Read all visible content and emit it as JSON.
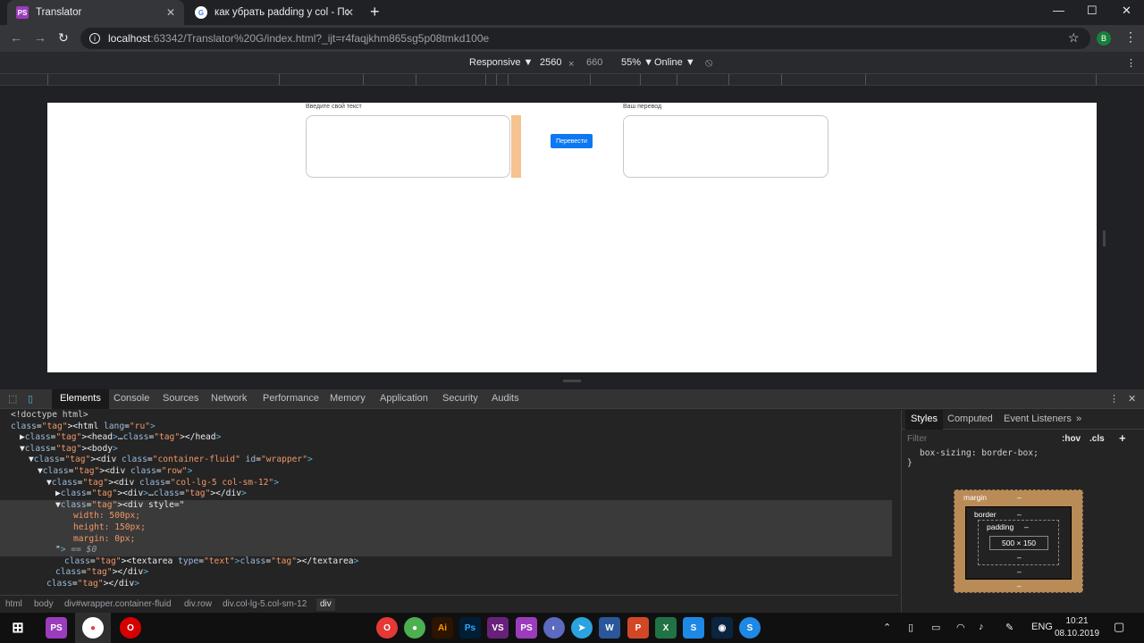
{
  "browser": {
    "tabs": [
      {
        "title": "Translator",
        "icon": "phpstorm-icon",
        "active": true
      },
      {
        "title": "как убрать padding у col - Поис",
        "icon": "google-icon",
        "active": false
      }
    ],
    "close_glyph": "✕",
    "new_tab_glyph": "+",
    "window_controls": {
      "minimize": "—",
      "maximize": "☐",
      "close": "✕"
    },
    "url": {
      "host": "localhost",
      "rest": ":63342/Translator%20G/index.html?_ijt=r4faqjkhm865sg5p08tmkd100e"
    },
    "nav": {
      "back": "←",
      "forward": "→",
      "reload": "↻",
      "info": "i",
      "star": "☆",
      "profile": "B",
      "menu": "⋮"
    }
  },
  "device_toolbar": {
    "mode": "Responsive ▼",
    "width": "2560",
    "times": "×",
    "height": "660",
    "zoom": "55% ▼",
    "network": "Online ▼",
    "rotate": "⦸",
    "menu": "⋮"
  },
  "page": {
    "input_label": "Введите свой текст",
    "output_label": "Ваш перевод",
    "button_label": "Перевести"
  },
  "devtools": {
    "tabs": [
      "Elements",
      "Console",
      "Sources",
      "Network",
      "Performance",
      "Memory",
      "Application",
      "Security",
      "Audits"
    ],
    "active_tab": "Elements",
    "menu_glyph": "⋮",
    "close_glyph": "✕",
    "dom_lines": [
      {
        "indent": 0,
        "html": "&lt;!doctype html&gt;",
        "cls": "txt"
      },
      {
        "indent": 0,
        "html": "&lt;html lang=\"ru\"&gt;"
      },
      {
        "indent": 1,
        "html": "▶&lt;head&gt;…&lt;/head&gt;"
      },
      {
        "indent": 1,
        "html": "▼&lt;body&gt;"
      },
      {
        "indent": 2,
        "html": "▼&lt;div class=\"container-fluid\" id=\"wrapper\"&gt;"
      },
      {
        "indent": 3,
        "html": "▼&lt;div class=\"row\"&gt;"
      },
      {
        "indent": 4,
        "html": "▼&lt;div class=\"col-lg-5 col-sm-12\"&gt;"
      },
      {
        "indent": 5,
        "html": "▶&lt;div&gt;…&lt;/div&gt;"
      },
      {
        "indent": 5,
        "html": "▼&lt;div style=\"",
        "sel": true
      },
      {
        "indent": 7,
        "html": "width: 500px;",
        "sel": true,
        "css": true
      },
      {
        "indent": 7,
        "html": "height: 150px;",
        "sel": true,
        "css": true
      },
      {
        "indent": 7,
        "html": "margin: 0px;",
        "sel": true,
        "css": true
      },
      {
        "indent": 5,
        "html": "\"&gt; == $0",
        "sel": true
      },
      {
        "indent": 6,
        "html": "&lt;textarea type=\"text\"&gt;&lt;/textarea&gt;"
      },
      {
        "indent": 5,
        "html": "&lt;/div&gt;"
      },
      {
        "indent": 4,
        "html": "&lt;/div&gt;"
      }
    ],
    "breadcrumbs": [
      "html",
      "body",
      "div#wrapper.container-fluid",
      "div.row",
      "div.col-lg-5.col-sm-12",
      "div"
    ],
    "styles_tabs": [
      "Styles",
      "Computed",
      "Event Listeners",
      "»"
    ],
    "filter_placeholder": "Filter",
    "hov": ":hov",
    "cls": ".cls",
    "add": "+",
    "css_partial": "box-sizing: border-box;",
    "css_close": "}",
    "box_model": {
      "margin_label": "margin",
      "border_label": "border",
      "padding_label": "padding",
      "dash": "–",
      "content": "500 × 150"
    }
  },
  "taskbar": {
    "lang": "ENG",
    "time": "10:21",
    "date": "08.10.2019"
  }
}
